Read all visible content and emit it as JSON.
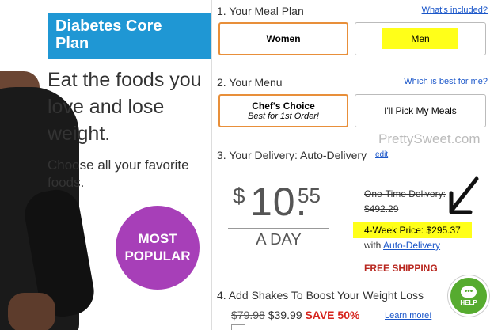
{
  "hero": {
    "brand_line1": "Diabetes Core",
    "brand_line2": "Plan",
    "headline": "Eat the foods you love and lose weight.",
    "subline": "Choose all your favorite foods.",
    "badge_line1": "MOST",
    "badge_line2": "POPULAR"
  },
  "meal_plan": {
    "title": "1. Your Meal Plan",
    "link": "What's included?",
    "options": [
      "Women",
      "Men"
    ],
    "selected": "Women",
    "highlight_color": "#ffff19"
  },
  "menu": {
    "title": "2. Your Menu",
    "link": "Which is best for me?",
    "chefs_choice": "Chef's Choice",
    "chefs_sub": "Best for 1st Order!",
    "pick": "I'll Pick My Meals"
  },
  "delivery": {
    "title": "3. Your Delivery: Auto-Delivery",
    "edit": "edit",
    "dollar": "$",
    "whole": "10.",
    "cents": "55",
    "per": "A DAY",
    "onetime_label": "One-Time Delivery:",
    "onetime_price": "$492.29",
    "fourweek": "4-Week Price: $295.37",
    "with_prefix": "with ",
    "with_link": "Auto-Delivery",
    "free_shipping": "FREE SHIPPING"
  },
  "shakes": {
    "title": "4. Add Shakes To Boost Your Weight Loss",
    "old_price": "$79.98",
    "new_price": "$39.99",
    "save": "SAVE 50%",
    "learn": "Learn more!"
  },
  "watermark": "PrettySweet.com",
  "help": {
    "label": "HELP",
    "icon": "chat-bubble-icon"
  },
  "colors": {
    "brand_blue": "#1f97d4",
    "badge_purple": "#a73fb8",
    "selected_border": "#e88f3a",
    "link_blue": "#1a56c9",
    "free_ship_red": "#b8261e",
    "help_green": "#56ab2f"
  }
}
